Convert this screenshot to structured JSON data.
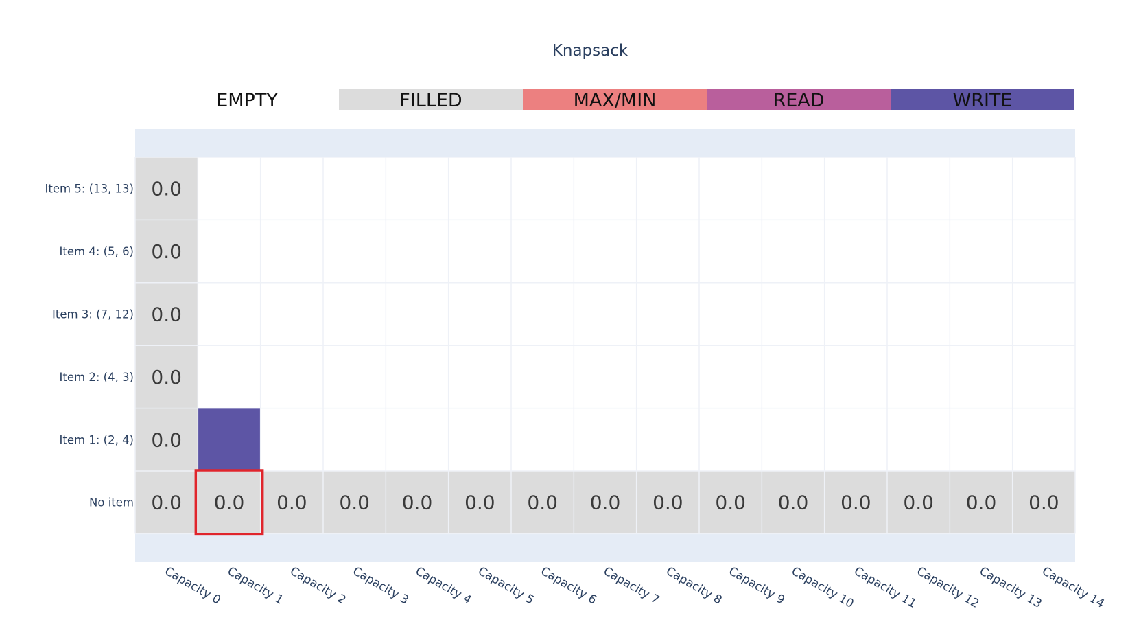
{
  "chart_data": {
    "type": "heatmap",
    "title": "Knapsack",
    "legend": {
      "placement": "top",
      "items": [
        {
          "label": "EMPTY",
          "color": "#ffffff"
        },
        {
          "label": "FILLED",
          "color": "#dcdcdc"
        },
        {
          "label": "MAX/MIN",
          "color": "#ec8080"
        },
        {
          "label": "READ",
          "color": "#b95f9c"
        },
        {
          "label": "WRITE",
          "color": "#5d55a5"
        }
      ]
    },
    "x_labels": [
      "Capacity 0",
      "Capacity 1",
      "Capacity 2",
      "Capacity 3",
      "Capacity 4",
      "Capacity 5",
      "Capacity 6",
      "Capacity 7",
      "Capacity 8",
      "Capacity 9",
      "Capacity 10",
      "Capacity 11",
      "Capacity 12",
      "Capacity 13",
      "Capacity 14"
    ],
    "y_labels": [
      "Item 5: (13, 13)",
      "Item 4: (5, 6)",
      "Item 3: (7, 12)",
      "Item 2: (4, 3)",
      "Item 1: (2, 4)",
      "No item"
    ],
    "states": [
      [
        "FILLED",
        "EMPTY",
        "EMPTY",
        "EMPTY",
        "EMPTY",
        "EMPTY",
        "EMPTY",
        "EMPTY",
        "EMPTY",
        "EMPTY",
        "EMPTY",
        "EMPTY",
        "EMPTY",
        "EMPTY",
        "EMPTY"
      ],
      [
        "FILLED",
        "EMPTY",
        "EMPTY",
        "EMPTY",
        "EMPTY",
        "EMPTY",
        "EMPTY",
        "EMPTY",
        "EMPTY",
        "EMPTY",
        "EMPTY",
        "EMPTY",
        "EMPTY",
        "EMPTY",
        "EMPTY"
      ],
      [
        "FILLED",
        "EMPTY",
        "EMPTY",
        "EMPTY",
        "EMPTY",
        "EMPTY",
        "EMPTY",
        "EMPTY",
        "EMPTY",
        "EMPTY",
        "EMPTY",
        "EMPTY",
        "EMPTY",
        "EMPTY",
        "EMPTY"
      ],
      [
        "FILLED",
        "EMPTY",
        "EMPTY",
        "EMPTY",
        "EMPTY",
        "EMPTY",
        "EMPTY",
        "EMPTY",
        "EMPTY",
        "EMPTY",
        "EMPTY",
        "EMPTY",
        "EMPTY",
        "EMPTY",
        "EMPTY"
      ],
      [
        "FILLED",
        "WRITE",
        "EMPTY",
        "EMPTY",
        "EMPTY",
        "EMPTY",
        "EMPTY",
        "EMPTY",
        "EMPTY",
        "EMPTY",
        "EMPTY",
        "EMPTY",
        "EMPTY",
        "EMPTY",
        "EMPTY"
      ],
      [
        "FILLED",
        "FILLED",
        "FILLED",
        "FILLED",
        "FILLED",
        "FILLED",
        "FILLED",
        "FILLED",
        "FILLED",
        "FILLED",
        "FILLED",
        "FILLED",
        "FILLED",
        "FILLED",
        "FILLED"
      ]
    ],
    "cell_text": [
      [
        "0.0",
        "",
        "",
        "",
        "",
        "",
        "",
        "",
        "",
        "",
        "",
        "",
        "",
        "",
        ""
      ],
      [
        "0.0",
        "",
        "",
        "",
        "",
        "",
        "",
        "",
        "",
        "",
        "",
        "",
        "",
        "",
        ""
      ],
      [
        "0.0",
        "",
        "",
        "",
        "",
        "",
        "",
        "",
        "",
        "",
        "",
        "",
        "",
        "",
        ""
      ],
      [
        "0.0",
        "",
        "",
        "",
        "",
        "",
        "",
        "",
        "",
        "",
        "",
        "",
        "",
        "",
        ""
      ],
      [
        "0.0",
        "",
        "",
        "",
        "",
        "",
        "",
        "",
        "",
        "",
        "",
        "",
        "",
        "",
        ""
      ],
      [
        "0.0",
        "0.0",
        "0.0",
        "0.0",
        "0.0",
        "0.0",
        "0.0",
        "0.0",
        "0.0",
        "0.0",
        "0.0",
        "0.0",
        "0.0",
        "0.0",
        "0.0"
      ]
    ],
    "highlight": {
      "row": 5,
      "col": 1,
      "color": "#e0252c"
    },
    "plot_background": "#e5ecf6",
    "grid_color": "#eef1f7"
  }
}
